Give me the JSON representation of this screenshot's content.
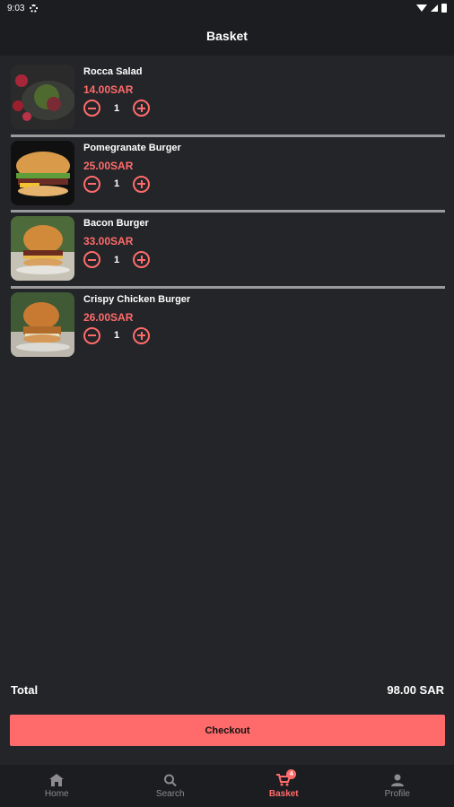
{
  "status": {
    "time": "9:03"
  },
  "header": {
    "title": "Basket"
  },
  "items": [
    {
      "name": "Rocca Salad",
      "price": "14.00SAR",
      "qty": "1"
    },
    {
      "name": "Pomegranate Burger",
      "price": "25.00SAR",
      "qty": "1"
    },
    {
      "name": "Bacon Burger",
      "price": "33.00SAR",
      "qty": "1"
    },
    {
      "name": "Crispy Chicken Burger",
      "price": "26.00SAR",
      "qty": "1"
    }
  ],
  "summary": {
    "total_label": "Total",
    "total_value": "98.00 SAR",
    "checkout_label": "Checkout"
  },
  "nav": [
    {
      "label": "Home",
      "icon": "home-icon"
    },
    {
      "label": "Search",
      "icon": "search-icon"
    },
    {
      "label": "Basket",
      "icon": "cart-icon",
      "badge": "4"
    },
    {
      "label": "Profile",
      "icon": "person-icon"
    }
  ],
  "colors": {
    "accent": "#ff6b6b",
    "background": "#242528",
    "bar": "#1c1d20"
  }
}
